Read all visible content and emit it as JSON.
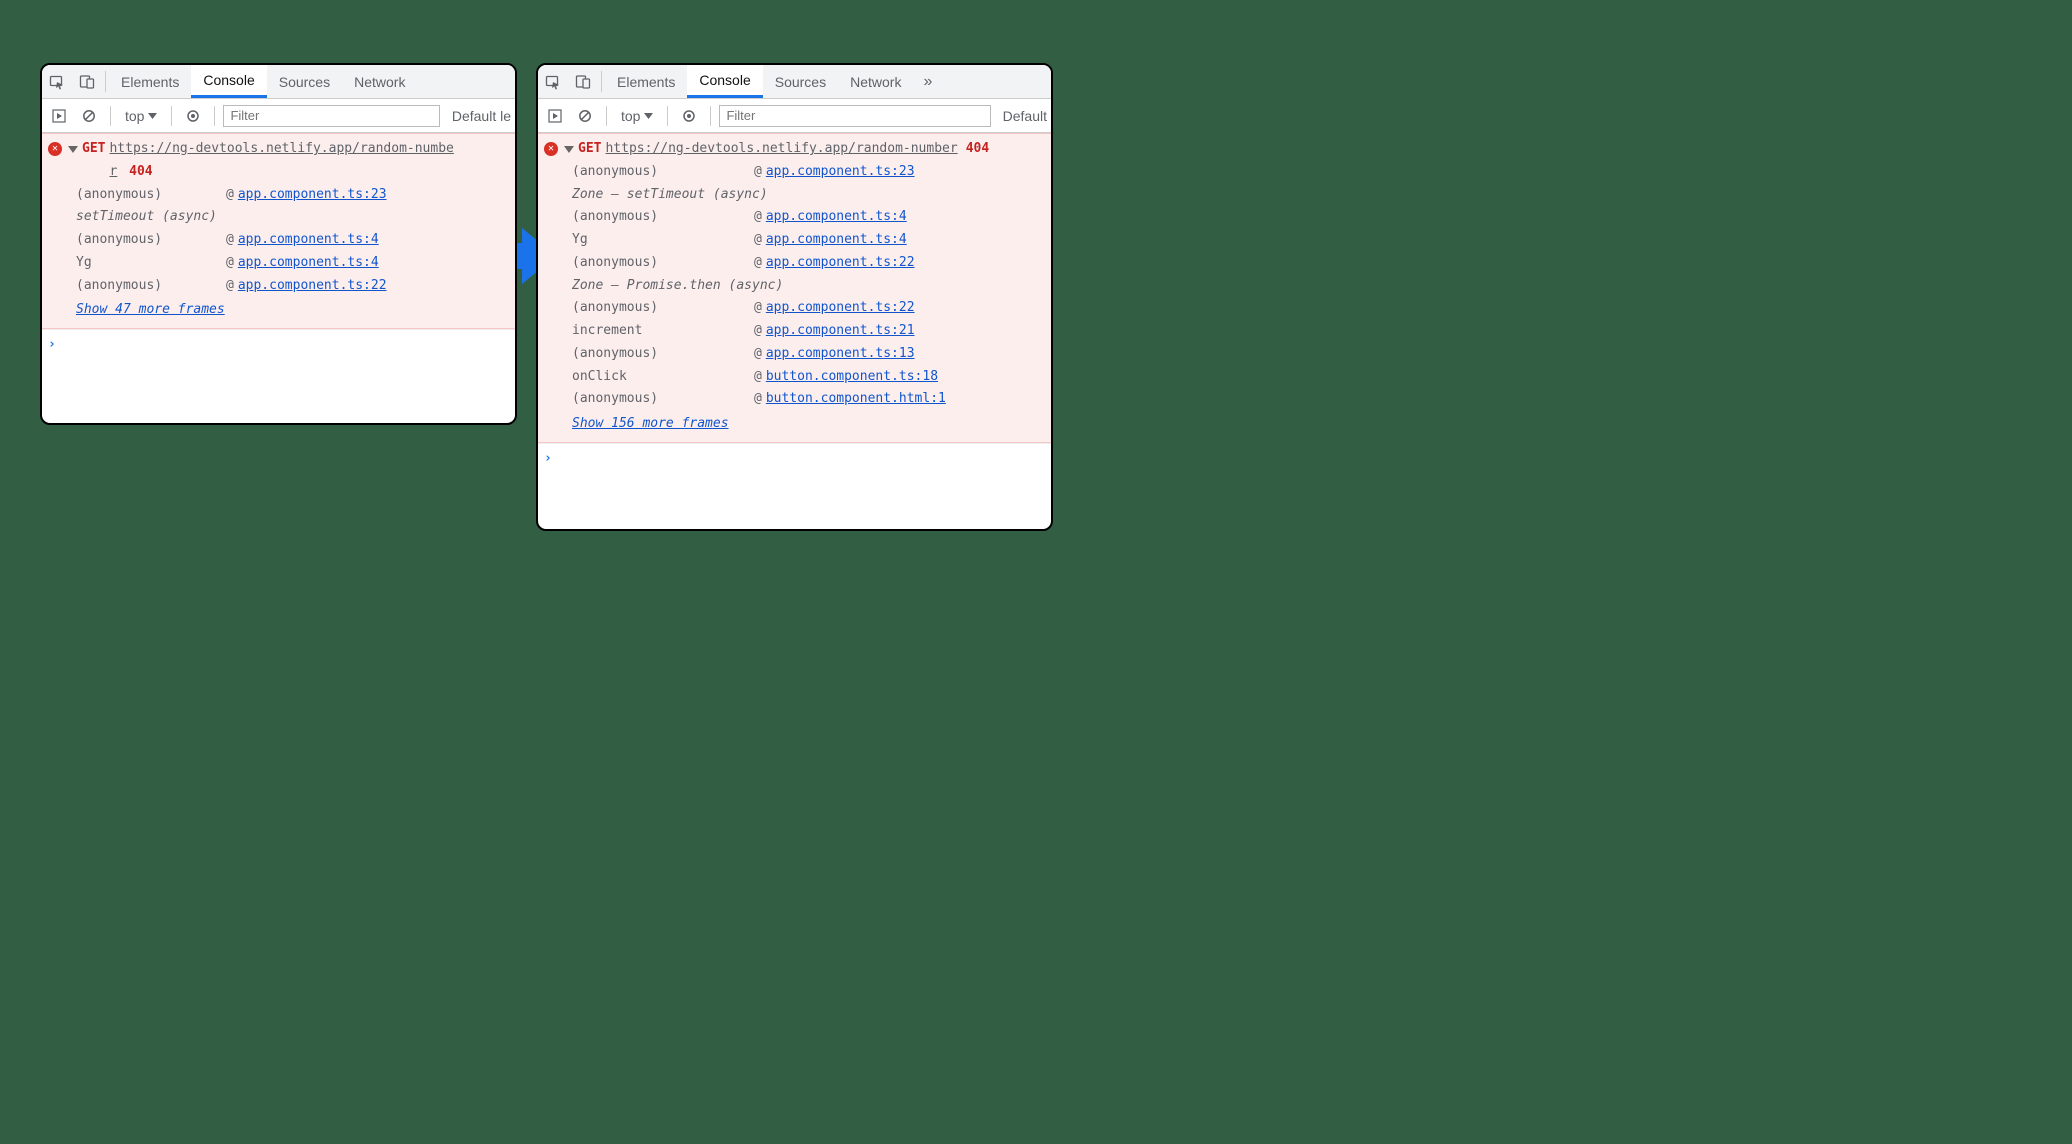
{
  "tabs": {
    "elements": "Elements",
    "console": "Console",
    "sources": "Sources",
    "network": "Network",
    "more": "»"
  },
  "toolbar": {
    "context": "top",
    "filter_placeholder": "Filter",
    "levels_left": "Default le",
    "levels_right": "Default"
  },
  "error": {
    "method": "GET",
    "url": "https://ng-devtools.netlify.app/random-number",
    "status": "404",
    "url_wrapped_prefix": "https://ng-devtools.netlify.app/random-numbe",
    "url_wrapped_suffix": "r",
    "at": "@"
  },
  "left": {
    "trace": [
      {
        "fn": "(anonymous)",
        "link": "app.component.ts:23"
      },
      {
        "async": "setTimeout (async)"
      },
      {
        "fn": "(anonymous)",
        "link": "app.component.ts:4"
      },
      {
        "fn": "Yg",
        "link": "app.component.ts:4"
      },
      {
        "fn": "(anonymous)",
        "link": "app.component.ts:22"
      }
    ],
    "show_more": "Show 47 more frames"
  },
  "right": {
    "trace": [
      {
        "fn": "(anonymous)",
        "link": "app.component.ts:23"
      },
      {
        "async": "Zone — setTimeout (async)"
      },
      {
        "fn": "(anonymous)",
        "link": "app.component.ts:4"
      },
      {
        "fn": "Yg",
        "link": "app.component.ts:4"
      },
      {
        "fn": "(anonymous)",
        "link": "app.component.ts:22"
      },
      {
        "async": "Zone — Promise.then (async)"
      },
      {
        "fn": "(anonymous)",
        "link": "app.component.ts:22"
      },
      {
        "fn": "increment",
        "link": "app.component.ts:21"
      },
      {
        "fn": "(anonymous)",
        "link": "app.component.ts:13"
      },
      {
        "fn": "onClick",
        "link": "button.component.ts:18"
      },
      {
        "fn": "(anonymous)",
        "link": "button.component.html:1"
      }
    ],
    "show_more": "Show 156 more frames"
  },
  "prompt": "›"
}
